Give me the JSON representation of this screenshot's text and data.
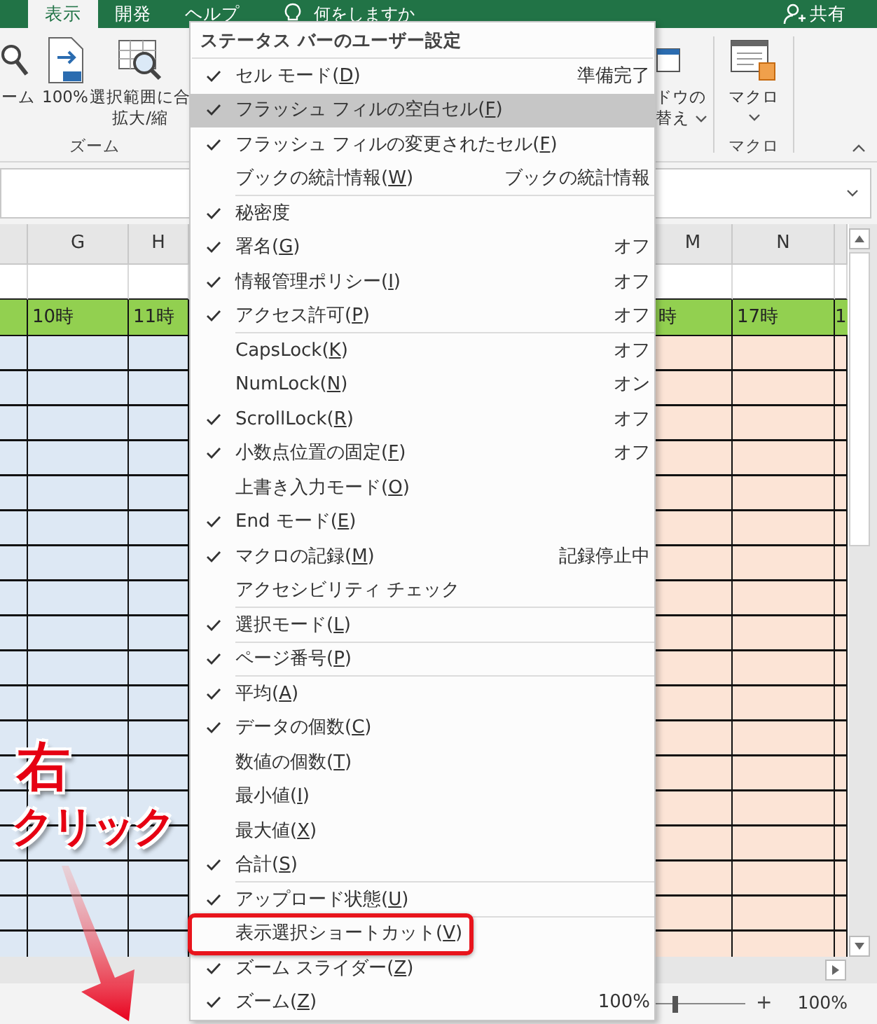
{
  "ribbon": {
    "tabs": [
      {
        "label": "表示",
        "selected": true
      },
      {
        "label": "開発",
        "selected": false
      },
      {
        "label": "ヘルプ",
        "selected": false
      }
    ],
    "tell_me": "何をしますか",
    "share": "共有",
    "zoom_group": {
      "label": "ズーム",
      "commands": [
        {
          "kind": "zoom",
          "lines": [
            "ーム"
          ],
          "dropdown": false
        },
        {
          "kind": "zoom100",
          "lines": [
            "100%"
          ],
          "dropdown": false
        },
        {
          "kind": "fit",
          "lines": [
            "選択範囲に合",
            "拡大/縮"
          ],
          "dropdown": false
        }
      ]
    },
    "window_group": {
      "commands": [
        {
          "kind": "window",
          "lines": [
            "ドウの",
            "替え"
          ],
          "dropdown": true
        }
      ]
    },
    "macro_group": {
      "label": "マクロ",
      "commands": [
        {
          "kind": "macro",
          "lines": [
            "マクロ"
          ],
          "dropdown": true
        }
      ]
    }
  },
  "sheet": {
    "left_columns": [
      {
        "color": "#dde8f4"
      },
      {
        "header": "G",
        "hour_cell": "10時",
        "color": "#dde8f4"
      },
      {
        "header": "H",
        "hour_cell": "11時",
        "color": "#dde8f4"
      }
    ],
    "right_columns": [
      {
        "header": "M",
        "hour_cell": "時",
        "color": "#fce4d6"
      },
      {
        "header": "N",
        "hour_cell": "17時",
        "color": "#fce4d6"
      },
      {
        "hour_cell": "1",
        "color": "#fce4d6"
      }
    ]
  },
  "status_bar": {
    "zoom_slider": {
      "level": 0.5
    },
    "zoom_in": "+",
    "zoom_percent": "100%"
  },
  "context_menu": {
    "title": "ステータス バーのユーザー設定",
    "items": [
      {
        "label": "セル モード(D)",
        "value": "準備完了",
        "checked": true,
        "highlighted": false,
        "boxed": false,
        "separator_after": false
      },
      {
        "label": "フラッシュ フィルの空白セル(F)",
        "checked": true,
        "highlighted": true,
        "boxed": false,
        "separator_after": false
      },
      {
        "label": "フラッシュ フィルの変更されたセル(F)",
        "checked": true,
        "highlighted": false,
        "boxed": false,
        "separator_after": false
      },
      {
        "label": "ブックの統計情報(W)",
        "value": "ブックの統計情報",
        "checked": false,
        "highlighted": false,
        "boxed": false,
        "separator_after": true
      },
      {
        "label": "秘密度",
        "checked": true,
        "highlighted": false,
        "boxed": false,
        "separator_after": false
      },
      {
        "label": "署名(G)",
        "value": "オフ",
        "checked": true,
        "highlighted": false,
        "boxed": false,
        "separator_after": false
      },
      {
        "label": "情報管理ポリシー(I)",
        "value": "オフ",
        "checked": true,
        "highlighted": false,
        "boxed": false,
        "separator_after": false
      },
      {
        "label": "アクセス許可(P)",
        "value": "オフ",
        "checked": true,
        "highlighted": false,
        "boxed": false,
        "separator_after": true
      },
      {
        "label": "CapsLock(K)",
        "value": "オフ",
        "checked": false,
        "highlighted": false,
        "boxed": false,
        "separator_after": false
      },
      {
        "label": "NumLock(N)",
        "value": "オン",
        "checked": false,
        "highlighted": false,
        "boxed": false,
        "separator_after": false
      },
      {
        "label": "ScrollLock(R)",
        "value": "オフ",
        "checked": true,
        "highlighted": false,
        "boxed": false,
        "separator_after": false
      },
      {
        "label": "小数点位置の固定(F)",
        "value": "オフ",
        "checked": true,
        "highlighted": false,
        "boxed": false,
        "separator_after": false
      },
      {
        "label": "上書き入力モード(O)",
        "checked": false,
        "highlighted": false,
        "boxed": false,
        "separator_after": false
      },
      {
        "label": "End モード(E)",
        "checked": true,
        "highlighted": false,
        "boxed": false,
        "separator_after": false
      },
      {
        "label": "マクロの記録(M)",
        "value": "記録停止中",
        "checked": true,
        "highlighted": false,
        "boxed": false,
        "separator_after": false
      },
      {
        "label": "アクセシビリティ チェック",
        "checked": false,
        "highlighted": false,
        "boxed": false,
        "separator_after": true
      },
      {
        "label": "選択モード(L)",
        "checked": true,
        "highlighted": false,
        "boxed": false,
        "separator_after": true
      },
      {
        "label": "ページ番号(P)",
        "checked": true,
        "highlighted": false,
        "boxed": false,
        "separator_after": true
      },
      {
        "label": "平均(A)",
        "checked": true,
        "highlighted": false,
        "boxed": false,
        "separator_after": false
      },
      {
        "label": "データの個数(C)",
        "checked": true,
        "highlighted": false,
        "boxed": false,
        "separator_after": false
      },
      {
        "label": "数値の個数(T)",
        "checked": false,
        "highlighted": false,
        "boxed": false,
        "separator_after": false
      },
      {
        "label": "最小値(I)",
        "checked": false,
        "highlighted": false,
        "boxed": false,
        "separator_after": false
      },
      {
        "label": "最大値(X)",
        "checked": false,
        "highlighted": false,
        "boxed": false,
        "separator_after": false
      },
      {
        "label": "合計(S)",
        "checked": true,
        "highlighted": false,
        "boxed": false,
        "separator_after": true
      },
      {
        "label": "アップロード状態(U)",
        "checked": true,
        "highlighted": false,
        "boxed": false,
        "separator_after": true
      },
      {
        "label": "表示選択ショートカット(V)",
        "checked": false,
        "highlighted": false,
        "boxed": true,
        "separator_after": false
      },
      {
        "label": "ズーム スライダー(Z)",
        "checked": true,
        "highlighted": false,
        "boxed": false,
        "separator_after": false
      },
      {
        "label": "ズーム(Z)",
        "value": "100%",
        "checked": true,
        "highlighted": false,
        "boxed": false,
        "separator_after": false
      }
    ]
  },
  "annotation": {
    "lines": [
      "右",
      "クリック"
    ]
  }
}
